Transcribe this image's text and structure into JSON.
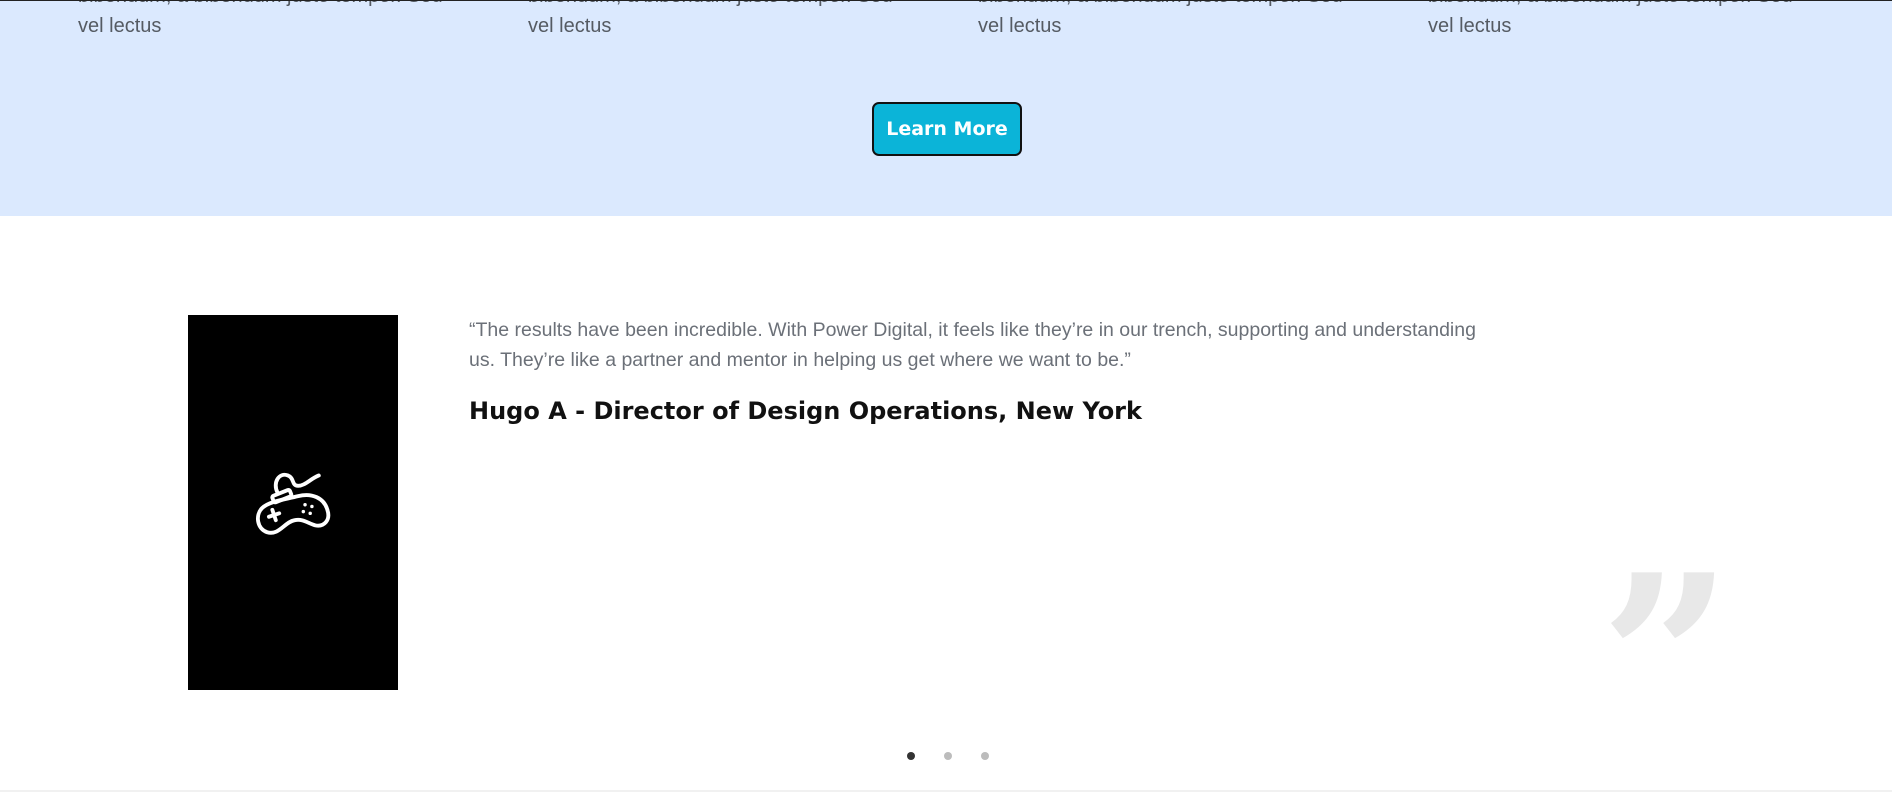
{
  "features": {
    "columns": [
      {
        "line1": "bibendum, a bibendum justo tempor. Sed",
        "line2": "vel lectus"
      },
      {
        "line1": "bibendum, a bibendum justo tempor. Sed",
        "line2": "vel lectus"
      },
      {
        "line1": "bibendum, a bibendum justo tempor. Sed",
        "line2": "vel lectus"
      },
      {
        "line1": "bibendum, a bibendum justo tempor. Sed",
        "line2": "vel lectus"
      }
    ],
    "learn_more_label": "Learn More",
    "background_color": "#dbe9fe",
    "button_color": "#0bb4d8"
  },
  "testimonial": {
    "avatar_icon": "gamepad-icon",
    "quote_line1": "“The results have been incredible. With Power Digital, it feels like they’re in our trench, supporting and understanding",
    "quote_line2": "us. They’re like a partner and mentor in helping us get where we want to be.”",
    "author": "Hugo A - Director of Design Operations, New York",
    "quote_mark": "”",
    "slides_total": 3,
    "active_slide": 1
  }
}
